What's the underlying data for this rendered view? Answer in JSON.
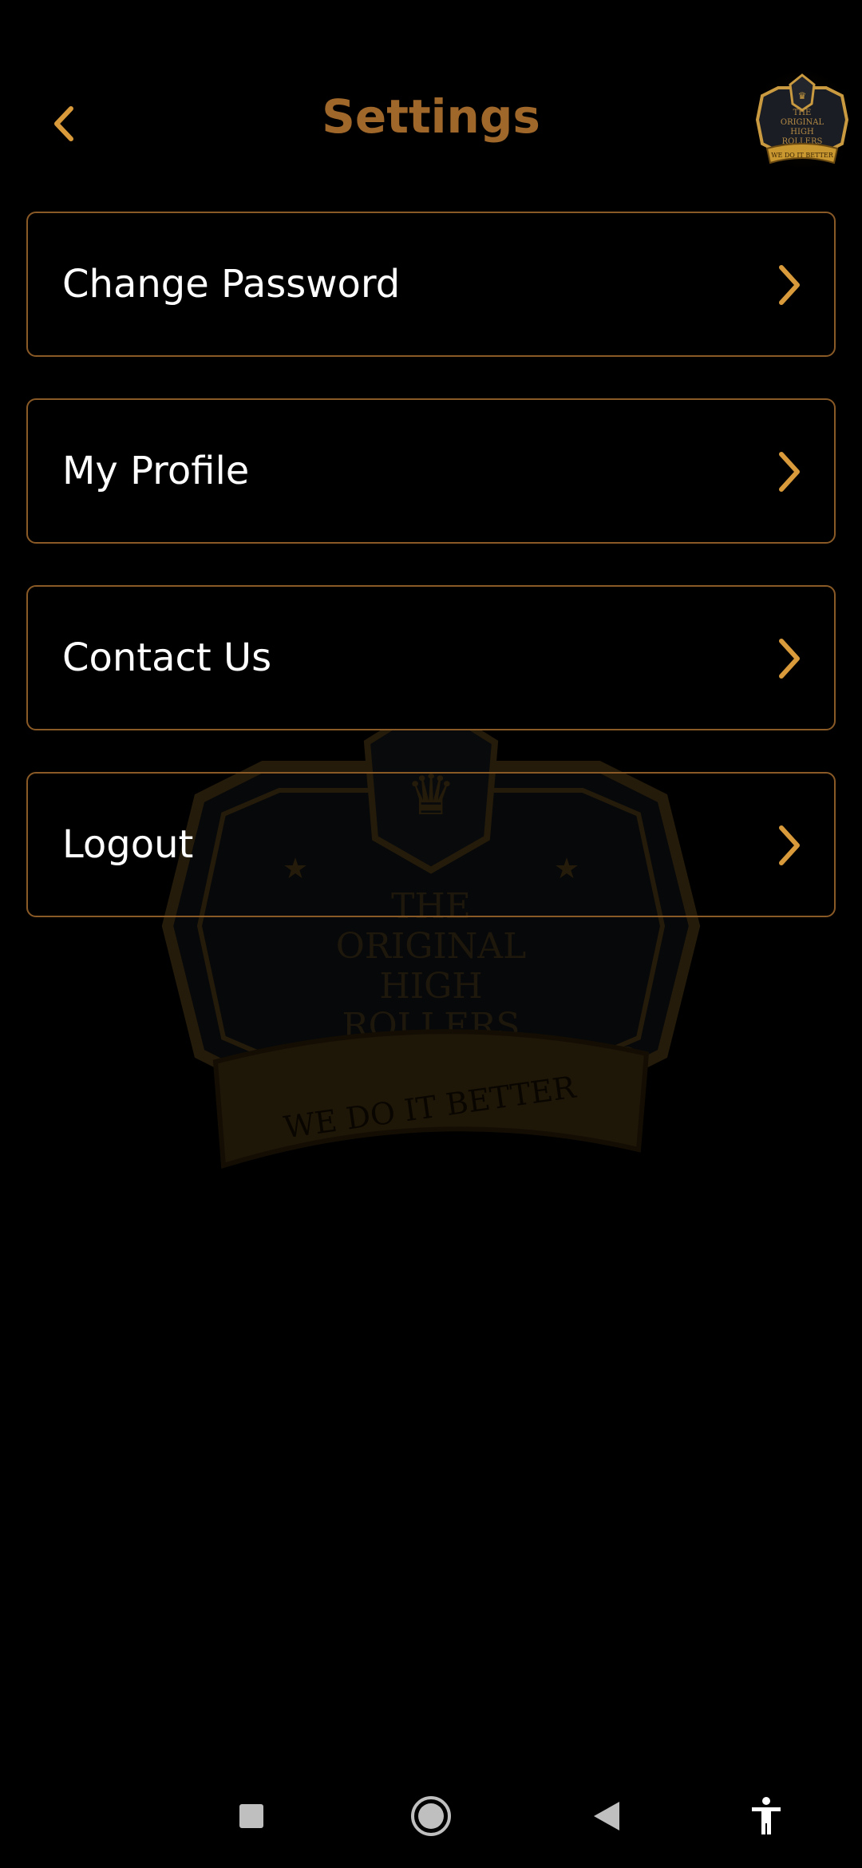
{
  "header": {
    "title": "Settings",
    "back_icon": "chevron-left-icon",
    "logo_lines": [
      "THE",
      "ORIGINAL",
      "HIGH",
      "ROLLERS"
    ],
    "logo_banner": "WE DO IT BETTER"
  },
  "watermark": {
    "lines": [
      "THE",
      "ORIGINAL",
      "HIGH",
      "ROLLERS"
    ],
    "banner": "WE DO IT BETTER",
    "copyright": "©"
  },
  "menu": {
    "items": [
      {
        "label": "Change Password",
        "icon": "chevron-right-icon"
      },
      {
        "label": "My Profile",
        "icon": "chevron-right-icon"
      },
      {
        "label": "Contact Us",
        "icon": "chevron-right-icon"
      },
      {
        "label": "Logout",
        "icon": "chevron-right-icon"
      }
    ]
  },
  "navbar": {
    "buttons": [
      "recents-icon",
      "home-icon",
      "back-icon",
      "accessibility-icon"
    ]
  },
  "colors": {
    "background": "#000000",
    "accent": "#a0672a",
    "border": "#8a5a26",
    "chevron": "#d89a3a",
    "text": "#ffffff"
  }
}
